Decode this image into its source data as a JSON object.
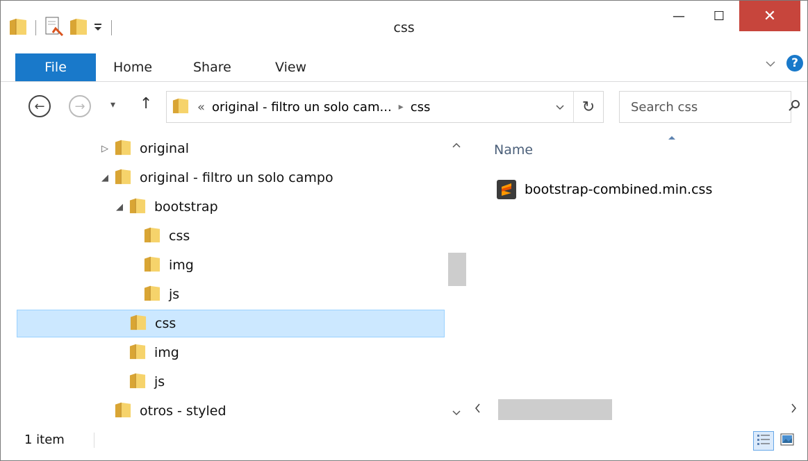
{
  "window": {
    "title": "css",
    "close_symbol": "✕",
    "minimize_symbol": "—",
    "maximize_symbol": "☐"
  },
  "quick_access": {
    "icons": [
      "folder-icon",
      "properties-icon",
      "new-folder-icon",
      "customize-dropdown-icon"
    ]
  },
  "ribbon": {
    "file_label": "File",
    "tabs": [
      "Home",
      "Share",
      "View"
    ],
    "help_label": "?"
  },
  "navigation": {
    "back_symbol": "←",
    "forward_symbol": "→",
    "recent_symbol": "▾",
    "up_symbol": "↑",
    "breadcrumb_overflow": "«",
    "breadcrumbs": [
      "original - filtro un solo cam...",
      "css"
    ],
    "breadcrumb_separator": "▸",
    "refresh_symbol": "↻",
    "search_placeholder": "Search css"
  },
  "tree": [
    {
      "label": "original",
      "expander": "▷",
      "level": 0,
      "selected": false
    },
    {
      "label": "original - filtro un solo campo",
      "expander": "◢",
      "level": 0,
      "selected": false
    },
    {
      "label": "bootstrap",
      "expander": "◢",
      "level": 1,
      "selected": false
    },
    {
      "label": "css",
      "expander": "",
      "level": 2,
      "selected": false
    },
    {
      "label": "img",
      "expander": "",
      "level": 2,
      "selected": false
    },
    {
      "label": "js",
      "expander": "",
      "level": 2,
      "selected": false
    },
    {
      "label": "css",
      "expander": "",
      "level": 1,
      "selected": true
    },
    {
      "label": "img",
      "expander": "",
      "level": 1,
      "selected": false
    },
    {
      "label": "js",
      "expander": "",
      "level": 1,
      "selected": false
    },
    {
      "label": "otros - styled",
      "expander": "",
      "level": 0,
      "selected": false
    }
  ],
  "content": {
    "column_name": "Name",
    "files": [
      {
        "name": "bootstrap-combined.min.css",
        "icon": "sublime-text-icon"
      }
    ]
  },
  "status": {
    "item_count": "1 item"
  },
  "colors": {
    "accent": "#1979ca",
    "selection": "#cce8ff",
    "selection_border": "#99d1ff",
    "close": "#c7453c"
  }
}
